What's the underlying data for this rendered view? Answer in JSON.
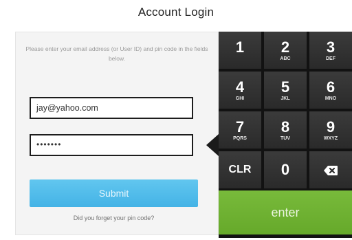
{
  "title": "Account Login",
  "instructions": "Please enter your email address (or User ID) and pin code in the fields below.",
  "email_value": "jay@yahoo.com",
  "pin_value": "•••••••",
  "submit_label": "Submit",
  "forgot_label": "Did you forget your pin code?",
  "keypad": {
    "k1": {
      "num": "1",
      "sub": ""
    },
    "k2": {
      "num": "2",
      "sub": "ABC"
    },
    "k3": {
      "num": "3",
      "sub": "DEF"
    },
    "k4": {
      "num": "4",
      "sub": "GHI"
    },
    "k5": {
      "num": "5",
      "sub": "JKL"
    },
    "k6": {
      "num": "6",
      "sub": "MNO"
    },
    "k7": {
      "num": "7",
      "sub": "PQRS"
    },
    "k8": {
      "num": "8",
      "sub": "TUV"
    },
    "k9": {
      "num": "9",
      "sub": "WXYZ"
    },
    "clr": "CLR",
    "k0": "0",
    "enter": "enter"
  },
  "colors": {
    "submit": "#4db9ea",
    "enter": "#6daf30",
    "keypad": "#121212"
  }
}
